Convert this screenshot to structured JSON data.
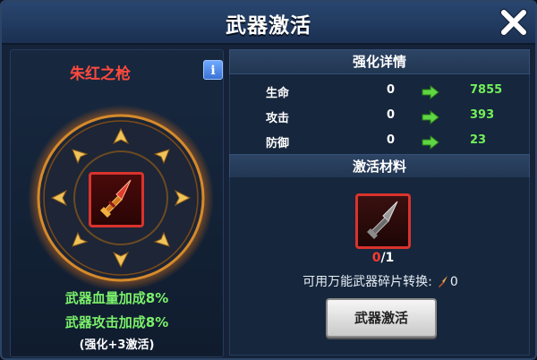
{
  "dialog": {
    "title": "武器激活",
    "close_icon": "close-x-icon"
  },
  "weapon": {
    "name": "朱红之枪",
    "info_label": "i",
    "bonus_lines": [
      "武器血量加成8%",
      "武器攻击加成8%"
    ],
    "bonus_note": "(强化+3激活)"
  },
  "details": {
    "header": "强化详情",
    "stats": [
      {
        "label": "生命",
        "before": "0",
        "after": "7855"
      },
      {
        "label": "攻击",
        "before": "0",
        "after": "393"
      },
      {
        "label": "防御",
        "before": "0",
        "after": "23"
      }
    ]
  },
  "materials": {
    "header": "激活材料",
    "have": "0",
    "need": "/1",
    "convert_text": "可用万能武器碎片转换:",
    "convert_count": "0",
    "activate_button": "武器激活"
  },
  "colors": {
    "stat_after": "#72ef5a",
    "weapon_name": "#ff4a3d",
    "bonus": "#7bf06a"
  }
}
